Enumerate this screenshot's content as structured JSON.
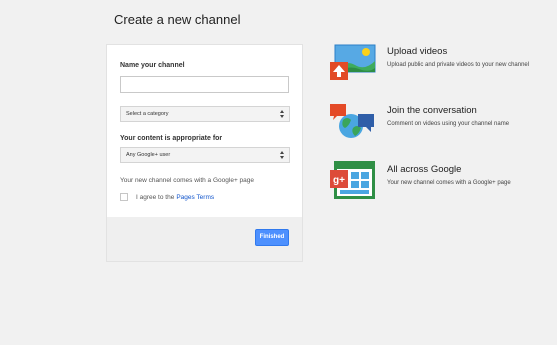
{
  "page": {
    "title": "Create a new channel"
  },
  "form": {
    "name_label": "Name your channel",
    "name_value": "",
    "category_selected": "Select a category",
    "content_label": "Your content is appropriate for",
    "content_selected": "Any Google+ user",
    "channel_note": "Your new channel comes with a Google+ page",
    "agree_text": "I agree to the",
    "terms_link": "Pages Terms",
    "agree_checked": false,
    "finished_label": "Finished"
  },
  "features": [
    {
      "icon": "upload-image-icon",
      "title": "Upload videos",
      "desc": "Upload public and private videos to your new channel"
    },
    {
      "icon": "conversation-icon",
      "title": "Join the conversation",
      "desc": "Comment on videos using your channel name"
    },
    {
      "icon": "google-plus-page-icon",
      "title": "All across Google",
      "desc": "Your new channel comes with a Google+ page"
    }
  ],
  "colors": {
    "accent_blue": "#4d90fe",
    "link_blue": "#1155cc",
    "background": "#f1f1f1"
  }
}
